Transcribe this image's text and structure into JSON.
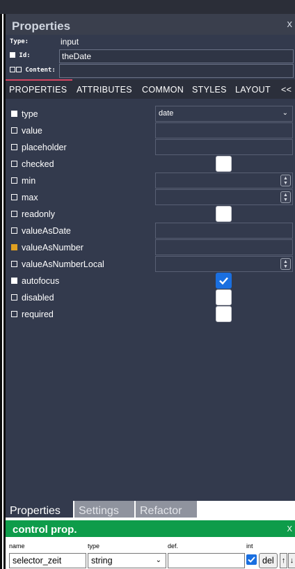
{
  "panel": {
    "title": "Properties",
    "close": "x",
    "meta": {
      "type_label": "Type:",
      "type_value": "input",
      "id_label": "Id:",
      "id_value": "theDate",
      "content_label": "Content:",
      "content_value": ""
    },
    "tabs": [
      "PROPERTIES",
      "ATTRIBUTES",
      "COMMON",
      "STYLES",
      "LAYOUT",
      "<<"
    ],
    "properties": [
      {
        "name": "type",
        "check": "filled",
        "control": "select",
        "value": "date"
      },
      {
        "name": "value",
        "check": "empty",
        "control": "input",
        "value": ""
      },
      {
        "name": "placeholder",
        "check": "empty",
        "control": "input",
        "value": ""
      },
      {
        "name": "checked",
        "check": "empty",
        "control": "checkbox",
        "checked": false
      },
      {
        "name": "min",
        "check": "empty",
        "control": "number",
        "value": ""
      },
      {
        "name": "max",
        "check": "empty",
        "control": "number",
        "value": ""
      },
      {
        "name": "readonly",
        "check": "empty",
        "control": "checkbox",
        "checked": false
      },
      {
        "name": "valueAsDate",
        "check": "empty",
        "control": "input",
        "value": ""
      },
      {
        "name": "valueAsNumber",
        "check": "orange",
        "control": "input",
        "value": ""
      },
      {
        "name": "valueAsNumberLocal",
        "check": "empty",
        "control": "number",
        "value": ""
      },
      {
        "name": "autofocus",
        "check": "filled",
        "control": "checkbox",
        "checked": true
      },
      {
        "name": "disabled",
        "check": "empty",
        "control": "checkbox",
        "checked": false
      },
      {
        "name": "required",
        "check": "empty",
        "control": "checkbox",
        "checked": false
      }
    ]
  },
  "bottom_tabs": [
    "Properties",
    "Settings",
    "Refactor"
  ],
  "control_prop": {
    "title": "control prop.",
    "close": "x",
    "labels": {
      "name": "name",
      "type": "type",
      "def": "def.",
      "int": "int"
    },
    "name_value": "selector_zeit",
    "type_value": "string",
    "def_value": "",
    "int_checked": true,
    "del_label": "del",
    "up_label": "↑",
    "down_label": "↓"
  },
  "colors": {
    "panel_bg": "#333a4d",
    "active_tab_underline": "#d64561",
    "header_green": "#0e9c4a",
    "check_blue": "#1a6fe0",
    "modified_orange": "#e0a020"
  }
}
